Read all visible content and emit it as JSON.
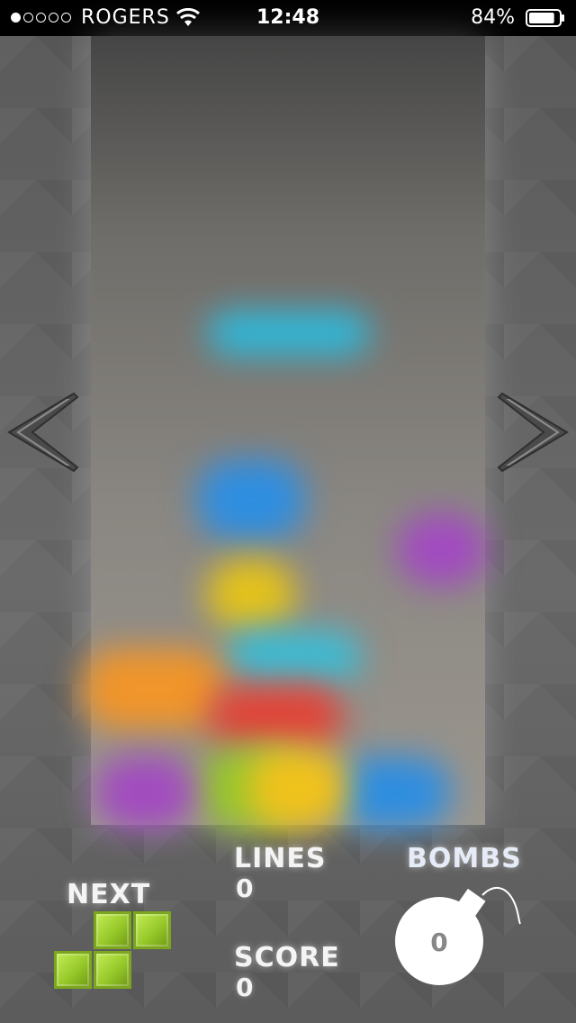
{
  "status_bar": {
    "signal_dots_filled": 1,
    "signal_dots_total": 5,
    "carrier": "ROGERS",
    "time": "12:48",
    "battery": "84%",
    "battery_level": 0.84
  },
  "board": {
    "nav_left_icon": "chevron-left-icon",
    "nav_right_icon": "chevron-right-icon",
    "blurred_piece_colors": [
      "#2fb7d8",
      "#2f8ee0",
      "#a24bc0",
      "#e3c21c",
      "#3cbcd4",
      "#f0952a",
      "#e0453a",
      "#96c62e",
      "#2f8ee0",
      "#a24bc0",
      "#f0c21c"
    ]
  },
  "hud": {
    "next_label": "NEXT",
    "next_piece_color": "#a6d63a",
    "lines_label": "LINES",
    "lines_value": "0",
    "score_label": "SCORE",
    "score_value": "0",
    "bombs_label": "BOMBS",
    "bombs_value": "0",
    "bomb_icon": "bomb-icon"
  }
}
